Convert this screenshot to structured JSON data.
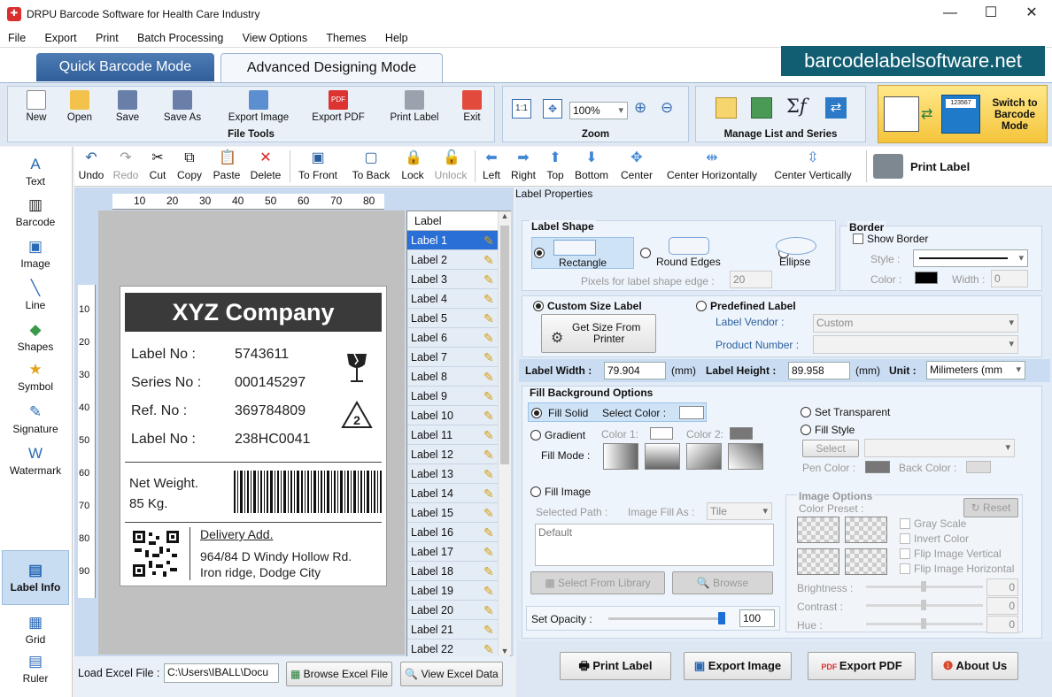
{
  "window": {
    "title": "DRPU Barcode Software for Health Care Industry",
    "minimize": "—",
    "maximize": "☐",
    "close": "✕"
  },
  "menu": [
    "File",
    "Export",
    "Print",
    "Batch Processing",
    "View Options",
    "Themes",
    "Help"
  ],
  "mode_tabs": {
    "quick": "Quick Barcode Mode",
    "advanced": "Advanced Designing Mode"
  },
  "brand_banner": "barcodelabelsoftware.net",
  "ribbon": {
    "file_tools": {
      "title": "File Tools",
      "buttons": [
        "New",
        "Open",
        "Save",
        "Save As",
        "Export Image",
        "Export PDF",
        "Print Label",
        "Exit"
      ]
    },
    "zoom": {
      "title": "Zoom",
      "fit_label": "1:1",
      "value": "100%"
    },
    "manage": {
      "title": "Manage List and Series"
    },
    "switch": {
      "line1": "Switch to",
      "line2": "Barcode",
      "line3": "Mode",
      "badge": "123567"
    }
  },
  "edit_toolbar": {
    "undo": "Undo",
    "redo": "Redo",
    "cut": "Cut",
    "copy": "Copy",
    "paste": "Paste",
    "delete": "Delete",
    "to_front": "To Front",
    "to_back": "To Back",
    "lock": "Lock",
    "unlock": "Unlock",
    "left": "Left",
    "right": "Right",
    "top": "Top",
    "bottom": "Bottom",
    "center": "Center",
    "center_h": "Center Horizontally",
    "center_v": "Center Vertically",
    "print_label": "Print Label"
  },
  "left_tools": [
    "Text",
    "Barcode",
    "Image",
    "Line",
    "Shapes",
    "Symbol",
    "Signature",
    "Watermark",
    "Label Info",
    "Grid",
    "Ruler"
  ],
  "ruler": {
    "top": [
      "10",
      "20",
      "30",
      "40",
      "50",
      "60",
      "70",
      "80"
    ],
    "left": [
      "10",
      "20",
      "30",
      "40",
      "50",
      "60",
      "70",
      "80",
      "90"
    ]
  },
  "label_design": {
    "company": "XYZ Company",
    "fields": [
      {
        "name": "Label No :",
        "value": "5743611"
      },
      {
        "name": "Series No :",
        "value": "000145297"
      },
      {
        "name": "Ref. No :",
        "value": "369784809"
      },
      {
        "name": "Label No :",
        "value": "238HC0041"
      }
    ],
    "recycle_number": "2",
    "weight_line1": "Net Weight.",
    "weight_line2": "85 Kg.",
    "delivery_title": "Delivery Add.",
    "address_line1": "964/84 D Windy Hollow Rd.",
    "address_line2": "Iron ridge, Dodge City"
  },
  "label_list": {
    "header": "Label",
    "items": [
      "Label 1",
      "Label 2",
      "Label 3",
      "Label 4",
      "Label 5",
      "Label 6",
      "Label 7",
      "Label 8",
      "Label 9",
      "Label 10",
      "Label 11",
      "Label 12",
      "Label 13",
      "Label 14",
      "Label 15",
      "Label 16",
      "Label 17",
      "Label 18",
      "Label 19",
      "Label 20",
      "Label 21",
      "Label 22"
    ],
    "selected": "Label 1"
  },
  "excel": {
    "label": "Load Excel File :",
    "path": "C:\\Users\\IBALL\\Docu",
    "browse": "Browse Excel File",
    "view": "View Excel Data"
  },
  "properties": {
    "title": "Label Properties",
    "shape": {
      "title": "Label Shape",
      "options": [
        "Rectangle",
        "Round Edges",
        "Ellipse"
      ],
      "selected": "Rectangle",
      "pixels_label": "Pixels for label shape edge :",
      "pixels_value": "20"
    },
    "border": {
      "title": "Border",
      "show": "Show Border",
      "style_label": "Style :",
      "color_label": "Color :",
      "width_label": "Width :",
      "width_value": "0"
    },
    "size": {
      "custom": "Custom Size Label",
      "get_size_line1": "Get Size From",
      "get_size_line2": "Printer",
      "predefined": "Predefined Label",
      "vendor_label": "Label Vendor :",
      "vendor_value": "Custom",
      "product_label": "Product Number :"
    },
    "dimensions": {
      "width_label": "Label Width :",
      "width_value": "79.904",
      "height_label": "Label Height :",
      "height_value": "89.958",
      "unit_suffix": "(mm)",
      "unit_label": "Unit :",
      "unit_value": "Milimeters (mm"
    },
    "fill": {
      "title": "Fill Background Options",
      "solid": "Fill Solid",
      "select_color": "Select Color :",
      "transparent": "Set Transparent",
      "gradient": "Gradient",
      "color1": "Color 1:",
      "color2": "Color 2:",
      "fill_mode": "Fill Mode :",
      "fill_style": "Fill Style",
      "select": "Select",
      "pen_color": "Pen Color :",
      "back_color": "Back Color :",
      "fill_image": "Fill Image",
      "selected_path": "Selected Path :",
      "image_fill_as": "Image Fill As :",
      "tile": "Tile",
      "path_default": "Default",
      "library": "Select From Library",
      "browse": "Browse",
      "opacity_label": "Set Opacity :",
      "opacity_value": "100",
      "opacity_fraction": 1.0
    },
    "image_options": {
      "title": "Image Options",
      "preset": "Color Preset :",
      "reset": "Reset",
      "checks": [
        "Gray Scale",
        "Invert Color",
        "Flip Image Vertical",
        "Flip Image Horizontal"
      ],
      "brightness": "Brightness :",
      "contrast": "Contrast :",
      "hue": "Hue :",
      "zero": "0"
    }
  },
  "bottom_buttons": {
    "print": "Print Label",
    "export_image": "Export Image",
    "export_pdf": "Export PDF",
    "about": "About Us"
  }
}
